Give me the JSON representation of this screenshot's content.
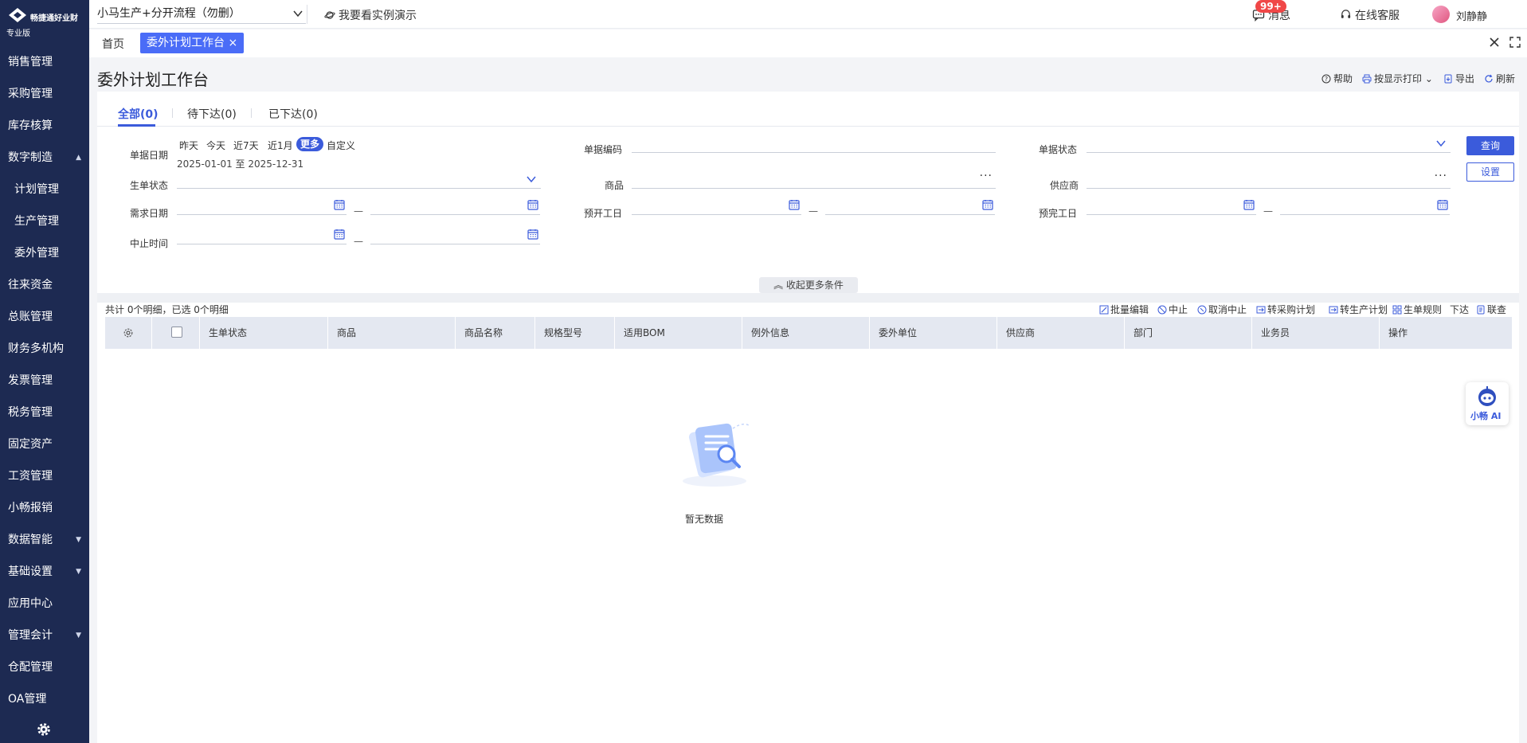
{
  "sidebar": {
    "brand": "畅捷通好业财",
    "edition": "专业版",
    "items": [
      {
        "label": "销售管理"
      },
      {
        "label": "采购管理"
      },
      {
        "label": "库存核算"
      },
      {
        "label": "数字制造",
        "expanded": true
      },
      {
        "label": "计划管理",
        "sub": true
      },
      {
        "label": "生产管理",
        "sub": true
      },
      {
        "label": "委外管理",
        "sub": true
      },
      {
        "label": "往来资金"
      },
      {
        "label": "总账管理"
      },
      {
        "label": "财务多机构"
      },
      {
        "label": "发票管理"
      },
      {
        "label": "税务管理"
      },
      {
        "label": "固定资产"
      },
      {
        "label": "工资管理"
      },
      {
        "label": "小畅报销"
      },
      {
        "label": "数据智能",
        "collapsed": true
      },
      {
        "label": "基础设置",
        "collapsed": true
      },
      {
        "label": "应用中心"
      },
      {
        "label": "管理会计",
        "collapsed": true
      },
      {
        "label": "仓配管理"
      },
      {
        "label": "OA管理"
      }
    ]
  },
  "topbar": {
    "project": "小马生产+分开流程（勿删）",
    "demo": "我要看实例演示",
    "messages": "消息",
    "badge": "99+",
    "service": "在线客服",
    "user": "刘静静"
  },
  "tabbar": {
    "home": "首页",
    "active": "委外计划工作台",
    "close": "×"
  },
  "page": {
    "title": "委外计划工作台",
    "actions": {
      "help": "帮助",
      "print": "按显示打印",
      "export": "导出",
      "refresh": "刷新"
    }
  },
  "tabs": [
    {
      "label": "全部(0)",
      "active": true
    },
    {
      "label": "待下达(0)"
    },
    {
      "label": "已下达(0)"
    }
  ],
  "filters": {
    "doc_date_label": "单据日期",
    "date_chips": [
      "昨天",
      "今天",
      "近7天",
      "近1月",
      "更多",
      "自定义"
    ],
    "selected_chip": "更多",
    "date_range": "2025-01-01 至 2025-12-31",
    "doc_code_label": "单据编码",
    "doc_status_label": "单据状态",
    "gen_status_label": "生单状态",
    "product_label": "商品",
    "supplier_label": "供应商",
    "demand_date_label": "需求日期",
    "plan_start_label": "预开工日",
    "plan_end_label": "预完工日",
    "stop_time_label": "中止时间",
    "dash": "—",
    "query_btn": "查询",
    "settings_btn": "设置",
    "collapse": "收起更多条件"
  },
  "table": {
    "summary": "共计 0个明细，已选 0个明细",
    "toolbar": [
      "批量编辑",
      "中止",
      "取消中止",
      "转采购计划",
      "转生产计划",
      "生单规则",
      "下达",
      "联查"
    ],
    "columns": [
      "生单状态",
      "商品",
      "商品名称",
      "规格型号",
      "适用BOM",
      "例外信息",
      "委外单位",
      "供应商",
      "部门",
      "业务员",
      "操作"
    ],
    "rows": [],
    "empty": "暂无数据"
  },
  "ai": {
    "label": "小畅 AI"
  },
  "colors": {
    "sidebar": "#1d2a52",
    "accent": "#3b5bdb",
    "tab_active": "#4a6cf7",
    "badge": "#f04747",
    "table_header": "#e4e8f1"
  }
}
